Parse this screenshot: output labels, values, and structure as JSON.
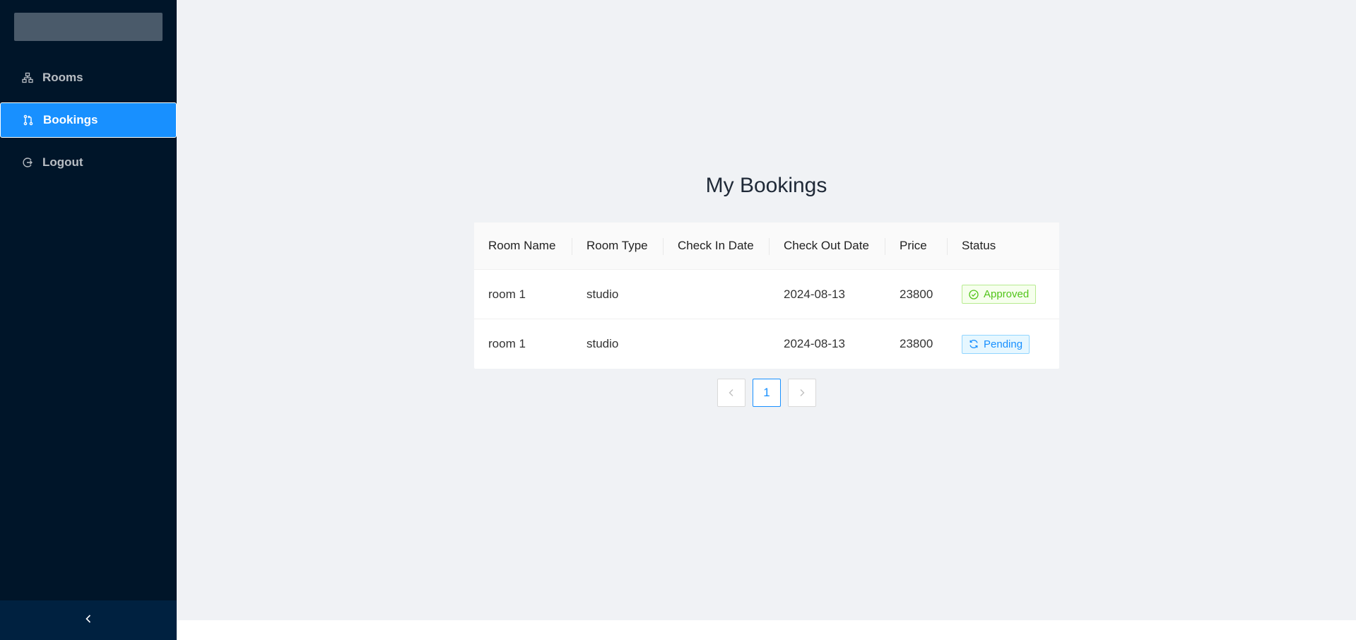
{
  "sidebar": {
    "items": [
      {
        "label": "Rooms",
        "icon": "hierarchy-icon",
        "active": false
      },
      {
        "label": "Bookings",
        "icon": "pull-request-icon",
        "active": true
      },
      {
        "label": "Logout",
        "icon": "logout-icon",
        "active": false
      }
    ],
    "collapse_icon": "chevron-left-icon"
  },
  "main": {
    "title": "My Bookings",
    "table": {
      "columns": [
        "Room Name",
        "Room Type",
        "Check In Date",
        "Check Out Date",
        "Price",
        "Status"
      ],
      "rows": [
        {
          "room_name": "room 1",
          "room_type": "studio",
          "check_in": "",
          "check_out": "2024-08-13",
          "price": "23800",
          "status": "Approved",
          "status_type": "success"
        },
        {
          "room_name": "room 1",
          "room_type": "studio",
          "check_in": "",
          "check_out": "2024-08-13",
          "price": "23800",
          "status": "Pending",
          "status_type": "processing"
        }
      ]
    },
    "pagination": {
      "current_page": "1"
    }
  },
  "colors": {
    "sidebar_bg": "#001529",
    "accent": "#1890ff",
    "success": "#52c41a",
    "content_bg": "#f0f2f5"
  }
}
